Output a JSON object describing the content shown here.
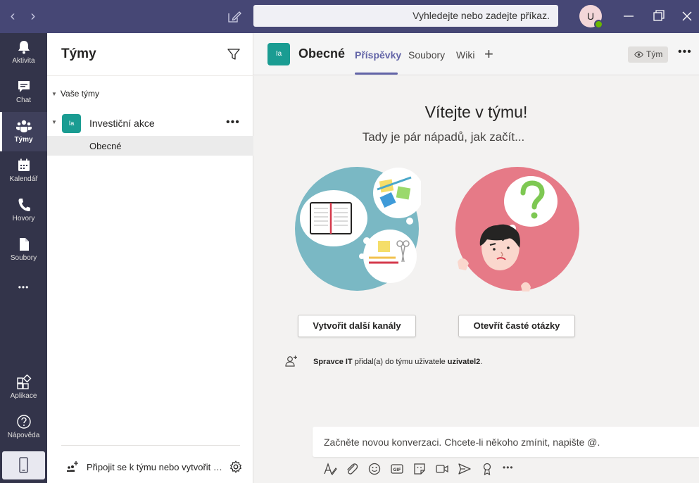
{
  "titlebar": {
    "search_placeholder": "Vyhledejte nebo zadejte příkaz.",
    "avatar_initial": "U",
    "back_glyph": "‹",
    "forward_glyph": "›"
  },
  "rail": {
    "items": [
      {
        "label": "Aktivita",
        "icon": "bell-icon"
      },
      {
        "label": "Chat",
        "icon": "chat-icon"
      },
      {
        "label": "Týmy",
        "icon": "teams-icon",
        "active": true
      },
      {
        "label": "Kalendář",
        "icon": "calendar-icon"
      },
      {
        "label": "Hovory",
        "icon": "phone-icon"
      },
      {
        "label": "Soubory",
        "icon": "file-icon"
      },
      {
        "label": "Aplikace",
        "icon": "apps-icon"
      },
      {
        "label": "Nápověda",
        "icon": "help-icon"
      }
    ],
    "more_glyph": "•••"
  },
  "teams": {
    "title": "Týmy",
    "section_label": "Vaše týmy",
    "team": {
      "avatar": "Ia",
      "name": "Investiční akce",
      "more": "•••"
    },
    "channel": "Obecné",
    "join_text": "Připojit se k týmu nebo vytvořit nový"
  },
  "channel_header": {
    "avatar": "Ia",
    "title": "Obecné",
    "tabs": [
      "Příspěvky",
      "Soubory",
      "Wiki"
    ],
    "add_tab": "+",
    "team_button": "Tým",
    "more": "•••"
  },
  "welcome": {
    "title": "Vítejte v týmu!",
    "subtitle": "Tady je pár nápadů, jak začít...",
    "create_channels_button": "Vytvořit další kanály",
    "faq_button": "Otevřít časté otázky"
  },
  "activity": {
    "actor": "Spravce IT",
    "action": "přidal(a) do týmu uživatele",
    "target": "uzivatel2",
    "end": "."
  },
  "compose": {
    "placeholder": "Začněte novou konverzaci. Chcete-li někoho zmínit, napište @.",
    "more": "•••"
  },
  "colors": {
    "titlebar": "#464775",
    "rail": "#33344a",
    "accent": "#6264a7",
    "team_avatar": "#1a9c92",
    "illus_blue": "#7ab8c4",
    "illus_pink": "#e67a87"
  }
}
